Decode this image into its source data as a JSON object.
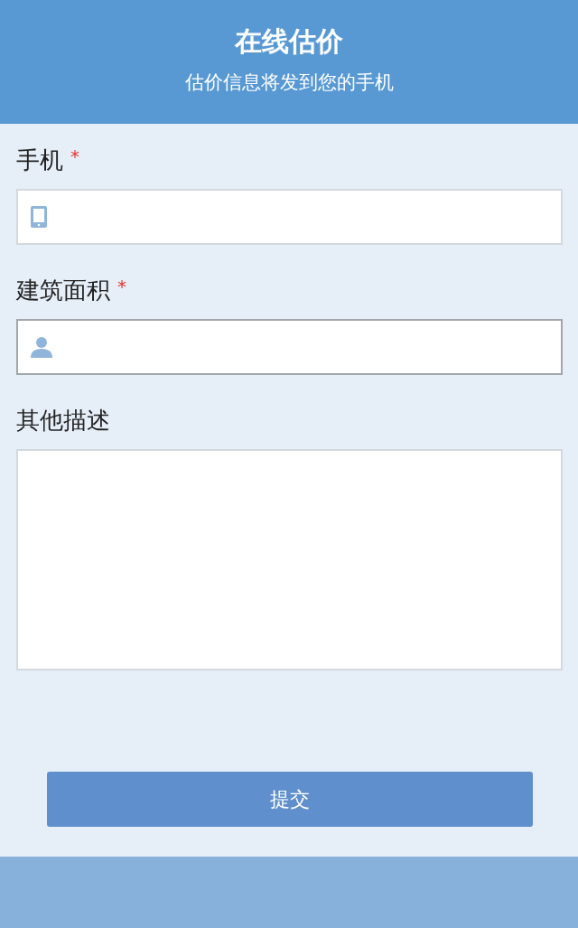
{
  "header": {
    "title": "在线估价",
    "subtitle": "估价信息将发到您的手机"
  },
  "fields": [
    {
      "kind": "phone",
      "label": "手机",
      "required_mark": "*",
      "focused": false
    },
    {
      "kind": "area",
      "label": "建筑面积",
      "required_mark": "*",
      "focused": true
    },
    {
      "kind": "textarea",
      "label": "其他描述",
      "focused": false
    }
  ],
  "submit_button": "提交"
}
